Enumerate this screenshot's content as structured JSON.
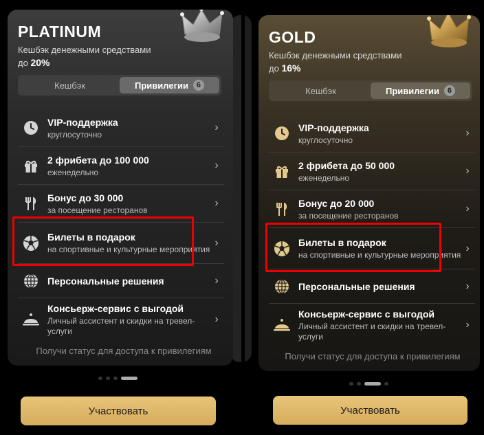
{
  "panels": [
    {
      "tier": "PLATINUM",
      "cashback_line1": "Кешбэк денежными средствами",
      "cashback_prefix": "до",
      "cashback_value": "20%",
      "tabs": {
        "cashback": "Кешбэк",
        "privileges": "Привилегии",
        "count": "6"
      },
      "items": [
        {
          "title": "VIP-поддержка",
          "sub": "круглосуточно"
        },
        {
          "title": "2 фрибета до 100 000",
          "sub": "еженедельно"
        },
        {
          "title": "Бонус до 30 000",
          "sub": "за посещение ресторанов"
        },
        {
          "title": "Билеты в подарок",
          "sub": "на спортивные и культурные мероприятия"
        },
        {
          "title": "Персональные решения",
          "sub": ""
        },
        {
          "title": "Консьерж-сервис с выгодой",
          "sub": "Личный ассистент и скидки на тревел-услуги"
        }
      ],
      "footer": "Получи статус для доступа к привилегиям",
      "cta": "Участвовать"
    },
    {
      "tier": "GOLD",
      "cashback_line1": "Кешбэк денежными средствами",
      "cashback_prefix": "до",
      "cashback_value": "16%",
      "tabs": {
        "cashback": "Кешбэк",
        "privileges": "Привилегии",
        "count": "6"
      },
      "items": [
        {
          "title": "VIP-поддержка",
          "sub": "круглосуточно"
        },
        {
          "title": "2 фрибета до 50 000",
          "sub": "еженедельно"
        },
        {
          "title": "Бонус до 20 000",
          "sub": "за посещение ресторанов"
        },
        {
          "title": "Билеты в подарок",
          "sub": "на спортивные и культурные мероприятия"
        },
        {
          "title": "Персональные решения",
          "sub": ""
        },
        {
          "title": "Консьерж-сервис с выгодой",
          "sub": "Личный ассистент и скидки на тревел-услуги"
        }
      ],
      "footer": "Получи статус для доступа к привилегиям",
      "cta": "Участвовать"
    }
  ],
  "colors": {
    "accent_gold": "#d6ad5c",
    "highlight_red": "#e00000"
  },
  "icons": [
    "clock-icon",
    "gift-icon",
    "fork-knife-icon",
    "football-icon",
    "globe-icon",
    "cloche-icon",
    "crown-icon",
    "chevron-right-icon"
  ]
}
